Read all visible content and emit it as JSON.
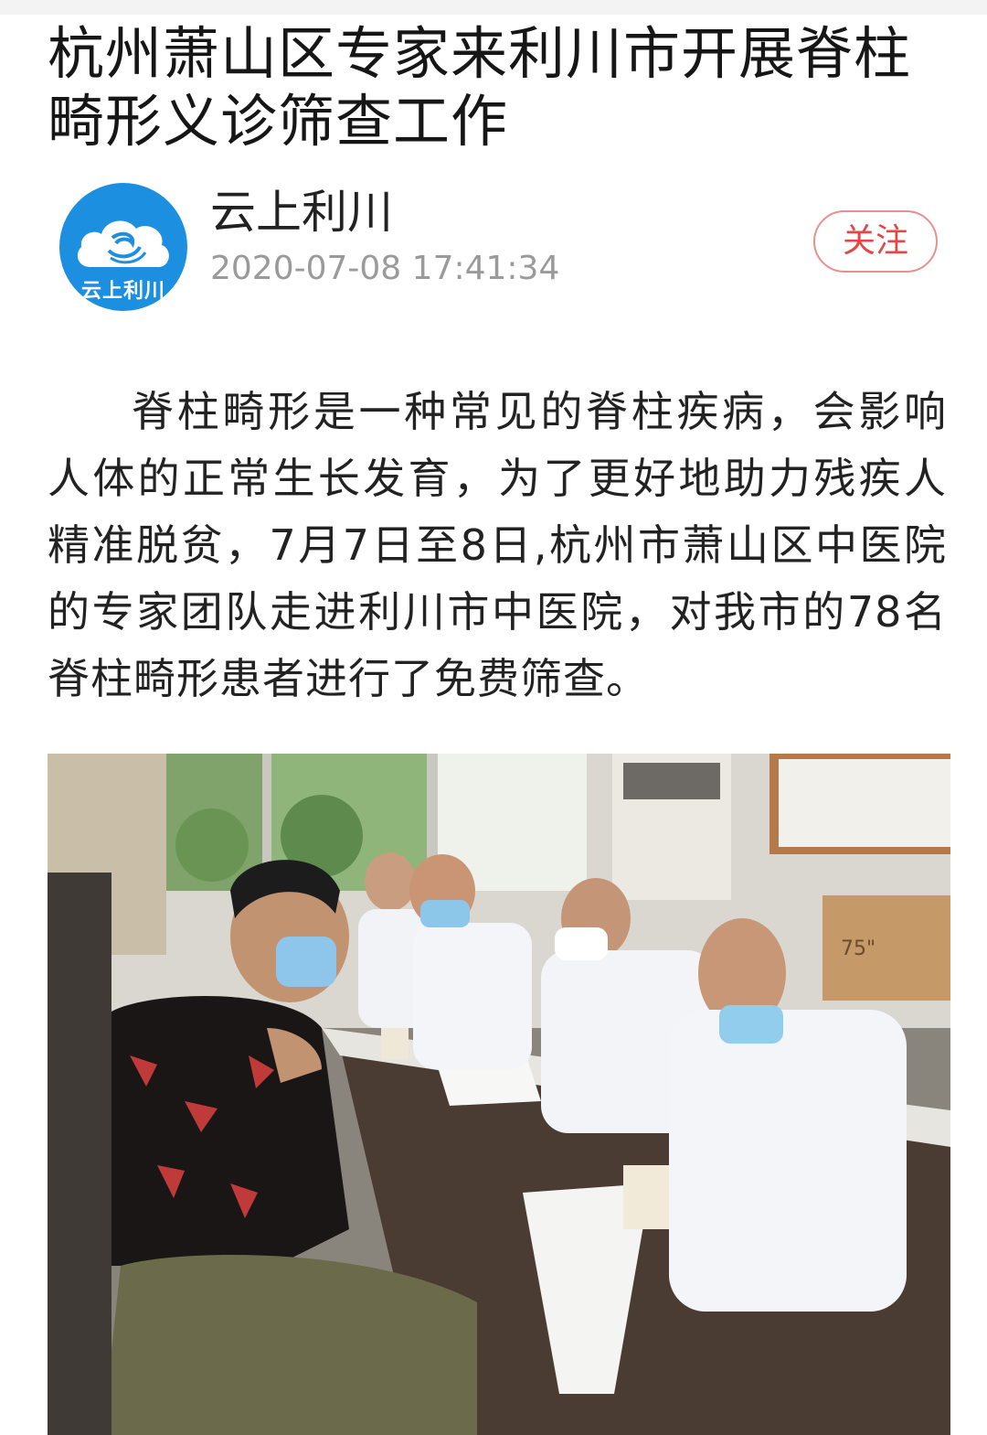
{
  "article": {
    "title": "杭州萧山区专家来利川市开展脊柱畸形义诊筛查工作",
    "author": {
      "name": "云上利川",
      "timestamp": "2020-07-08 17:41:34",
      "avatar_label": "云上利川",
      "avatar_color": "#1d8fe1"
    },
    "follow_label": "关注",
    "body": "脊柱畸形是一种常见的脊柱疾病，会影响人体的正常生长发育，为了更好地助力残疾人精准脱贫，7月7日至8日,杭州市萧山区中医院的专家团队走进利川市中医院，对我市的78名脊柱畸形患者进行了免费筛查。",
    "photo": {
      "icon": "photo-image",
      "box_label": "75\""
    }
  },
  "colors": {
    "follow_border": "#e98f8f",
    "follow_text": "#e64545",
    "timestamp": "#9a9a9a"
  }
}
